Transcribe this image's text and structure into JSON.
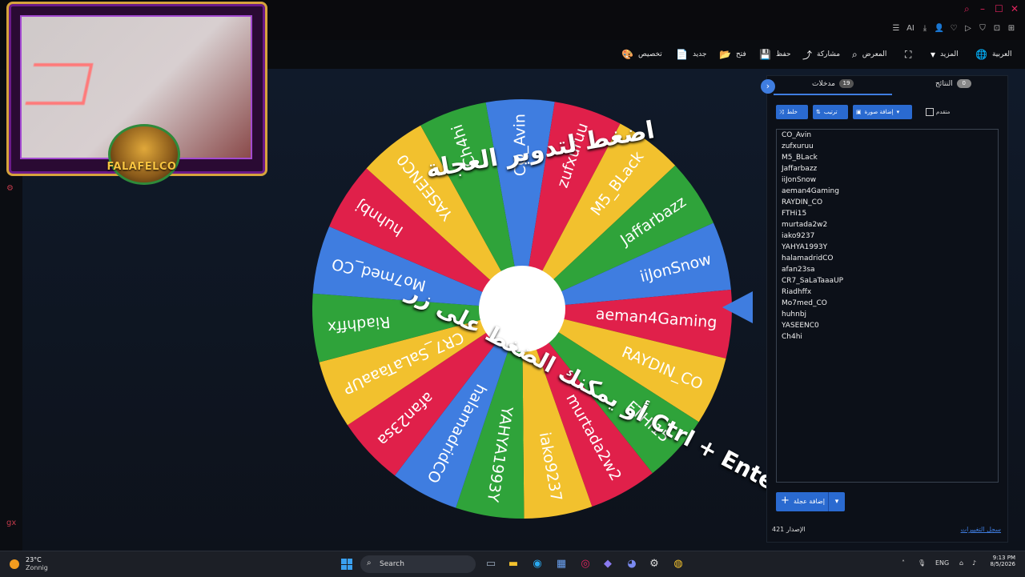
{
  "topbar": {
    "window_controls": [
      "⌕",
      "–",
      "☐",
      "✕"
    ],
    "nav_icons": [
      "☰",
      "🤖",
      "AI",
      "⤓",
      "👤",
      "♡",
      "▷",
      "⛉",
      "⊡",
      "⊞",
      "⊠"
    ]
  },
  "menubar": {
    "items": [
      {
        "label": "العربية",
        "icon": "globe-icon",
        "glyph": "🌐"
      },
      {
        "label": "المزيد",
        "icon": "chevron-down-icon",
        "glyph": "▾"
      },
      {
        "label": "",
        "icon": "fullscreen-icon",
        "glyph": "⛶"
      },
      {
        "label": "المعرض",
        "icon": "search-icon",
        "glyph": "⌕"
      },
      {
        "label": "مشاركة",
        "icon": "share-icon",
        "glyph": "⤴"
      },
      {
        "label": "حفظ",
        "icon": "save-icon",
        "glyph": "💾"
      },
      {
        "label": "فتح",
        "icon": "folder-icon",
        "glyph": "📂"
      },
      {
        "label": "جديد",
        "icon": "file-icon",
        "glyph": "📄"
      },
      {
        "label": "تخصيص",
        "icon": "palette-icon",
        "glyph": "🎨"
      }
    ]
  },
  "webcam": {
    "logo_text": "FALAFELCO"
  },
  "wheel": {
    "segments": [
      "CO_Avin",
      "zufxuruu",
      "M5_BLack",
      "Jaffarbazz",
      "iiJonSnow",
      "aeman4Gaming",
      "RAYDIN_CO",
      "FTHi15",
      "murtada2w2",
      "iako9237",
      "YAHYA1993Y",
      "halamadridCO",
      "afan23sa",
      "CR7_SaLaTaaaUP",
      "Riadhffx",
      "Mo7med_CO",
      "huhnbj",
      "YASEENC0",
      "Ch4hi"
    ],
    "colors": [
      "#3f7de0",
      "#e0204a",
      "#f2c12e",
      "#2fa33a"
    ],
    "overlay_top": "اضغط لتدوير العجلة",
    "overlay_bottom": "أو يمكنك الضغط على زر Ctrl + Enter"
  },
  "panel": {
    "tabs": [
      {
        "label": "مدخلات",
        "count": "19"
      },
      {
        "label": "النتائج",
        "count": "0"
      }
    ],
    "toolbar": {
      "shuffle": "خلط",
      "sort": "ترتيب",
      "add_image": "إضافة صورة",
      "advanced": "متقدم"
    },
    "entries": [
      "CO_Avin",
      "zufxuruu",
      "M5_BLack",
      "Jaffarbazz",
      "iiJonSnow",
      "aeman4Gaming",
      "RAYDIN_CO",
      "FTHi15",
      "murtada2w2",
      "iako9237",
      "YAHYA1993Y",
      "halamadridCO",
      "afan23sa",
      "CR7_SaLaTaaaUP",
      "Riadhffx",
      "Mo7med_CO",
      "huhnbj",
      "YASEENC0",
      "Ch4hi"
    ],
    "add_button": "إضافة عجلة",
    "version": "الإصدار 421",
    "changelog": "سجل التغييرات"
  },
  "taskbar": {
    "temperature": "23°C",
    "condition": "Zonnig",
    "search_placeholder": "Search",
    "language": "ENG",
    "time": "9:13 PM",
    "date": "8/5/2026"
  }
}
